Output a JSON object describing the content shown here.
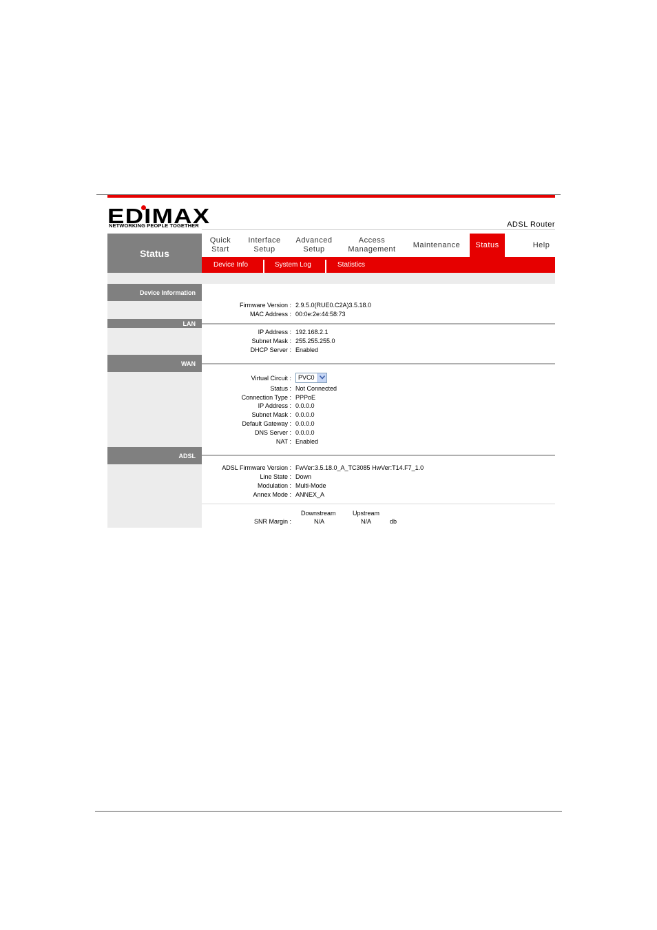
{
  "brand": {
    "logo_text": "EDIMAX",
    "tagline": "NETWORKING PEOPLE TOGETHER",
    "product": "ADSL Router",
    "accent_color": "#e60000"
  },
  "sidebar": {
    "title": "Status"
  },
  "nav": {
    "items": [
      {
        "line1": "Quick",
        "line2": "Start"
      },
      {
        "line1": "Interface",
        "line2": "Setup"
      },
      {
        "line1": "Advanced",
        "line2": "Setup"
      },
      {
        "line1": "Access",
        "line2": "Management"
      },
      {
        "line1": "Maintenance",
        "line2": ""
      },
      {
        "line1": "Status",
        "line2": ""
      },
      {
        "line1": "Help",
        "line2": ""
      }
    ],
    "active": "Status"
  },
  "subnav": {
    "items": [
      "Device Info",
      "System Log",
      "Statistics"
    ]
  },
  "device_info": {
    "heading": "Device Information",
    "firmware_label": "Firmware Version :",
    "firmware_value": "2.9.5.0(RUE0.C2A)3.5.18.0",
    "mac_label": "MAC Address :",
    "mac_value": "00:0e:2e:44:58:73"
  },
  "lan": {
    "heading": "LAN",
    "ip_label": "IP Address :",
    "ip_value": "192.168.2.1",
    "mask_label": "Subnet Mask :",
    "mask_value": "255.255.255.0",
    "dhcp_label": "DHCP Server :",
    "dhcp_value": "Enabled"
  },
  "wan": {
    "heading": "WAN",
    "vc_label": "Virtual Circuit :",
    "vc_value": "PVC0",
    "status_label": "Status :",
    "status_value": "Not Connected",
    "conn_label": "Connection Type :",
    "conn_value": "PPPoE",
    "ip_label": "IP Address :",
    "ip_value": "0.0.0.0",
    "mask_label": "Subnet Mask :",
    "mask_value": "0.0.0.0",
    "gw_label": "Default Gateway :",
    "gw_value": "0.0.0.0",
    "dns_label": "DNS Server :",
    "dns_value": "0.0.0.0",
    "nat_label": "NAT :",
    "nat_value": "Enabled"
  },
  "adsl": {
    "heading": "ADSL",
    "fw_label": "ADSL Firmware Version :",
    "fw_value": "FwVer:3.5.18.0_A_TC3085 HwVer:T14.F7_1.0",
    "line_label": "Line State :",
    "line_value": "Down",
    "mod_label": "Modulation :",
    "mod_value": "Multi-Mode",
    "annex_label": "Annex Mode :",
    "annex_value": "ANNEX_A",
    "downstream_header": "Downstream",
    "upstream_header": "Upstream",
    "snr_label": "SNR Margin :",
    "snr_down": "N/A",
    "snr_up": "N/A",
    "snr_unit": "db"
  }
}
